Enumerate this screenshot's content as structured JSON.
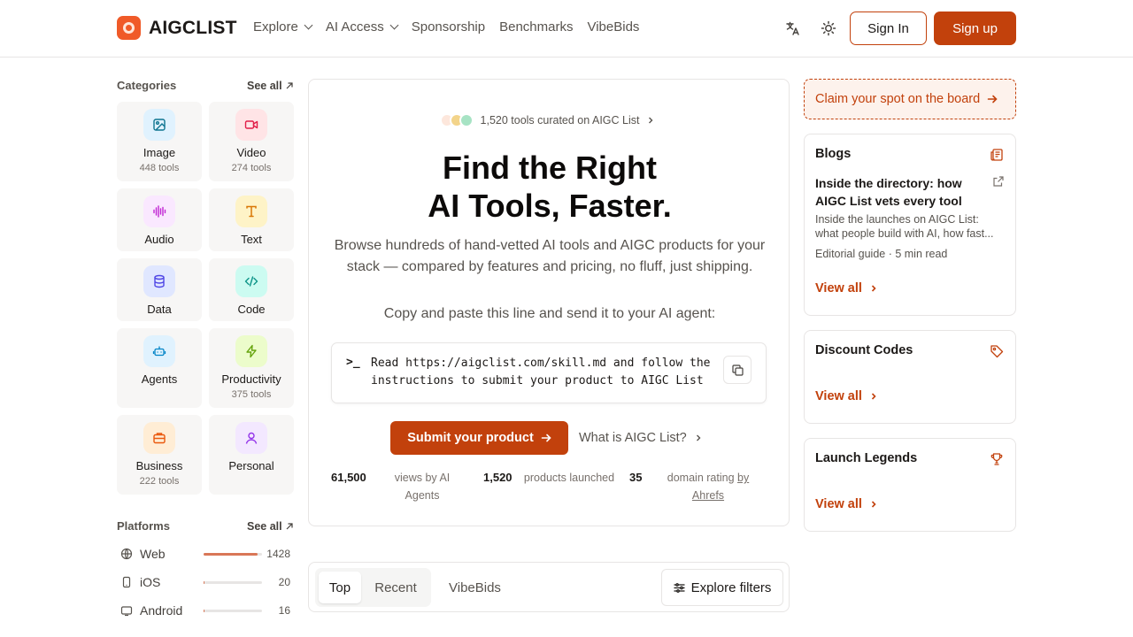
{
  "header": {
    "logo_text": "AIGCLIST",
    "nav": [
      {
        "label": "Explore",
        "dropdown": true
      },
      {
        "label": "AI Access",
        "dropdown": true
      },
      {
        "label": "Sponsorship",
        "dropdown": false
      },
      {
        "label": "Benchmarks",
        "dropdown": false
      },
      {
        "label": "VibeBids",
        "dropdown": false
      }
    ],
    "translate_icon": "translate-icon",
    "theme_icon": "sun-icon",
    "signin_label": "Sign In",
    "signup_label": "Sign up"
  },
  "categories": {
    "title": "Categories",
    "see_all": "See all",
    "items": [
      {
        "name": "Image",
        "count": "448 tools",
        "icon": "image-icon",
        "color": "#0e7490",
        "bg": "#e0f2fe"
      },
      {
        "name": "Video",
        "count": "274 tools",
        "icon": "video-icon",
        "color": "#e11d48",
        "bg": "#ffe4e6"
      },
      {
        "name": "Audio",
        "count": "",
        "icon": "audio-icon",
        "color": "#c026d3",
        "bg": "#fae8ff"
      },
      {
        "name": "Text",
        "count": "",
        "icon": "text-icon",
        "color": "#d97706",
        "bg": "#fef3c7"
      },
      {
        "name": "Data",
        "count": "",
        "icon": "database-icon",
        "color": "#4f46e5",
        "bg": "#e0e7ff"
      },
      {
        "name": "Code",
        "count": "",
        "icon": "code-icon",
        "color": "#0d9488",
        "bg": "#ccfbf1"
      },
      {
        "name": "Agents",
        "count": "",
        "icon": "robot-icon",
        "color": "#0284c7",
        "bg": "#e0f2fe"
      },
      {
        "name": "Productivity",
        "count": "375 tools",
        "icon": "lightning-icon",
        "color": "#65a30d",
        "bg": "#ecfccb"
      },
      {
        "name": "Business",
        "count": "222 tools",
        "icon": "briefcase-icon",
        "color": "#ea580c",
        "bg": "#ffedd5"
      },
      {
        "name": "Personal",
        "count": "",
        "icon": "user-icon",
        "color": "#9333ea",
        "bg": "#f3e8ff"
      }
    ]
  },
  "platforms": {
    "title": "Platforms",
    "see_all": "See all",
    "items": [
      {
        "name": "Web",
        "count": "1428",
        "share": 0.92,
        "icon": "globe-icon"
      },
      {
        "name": "iOS",
        "count": "20",
        "share": 0.015,
        "icon": "phone-icon"
      },
      {
        "name": "Android",
        "count": "16",
        "share": 0.012,
        "icon": "android-icon"
      }
    ]
  },
  "hero": {
    "curated": "1,520 tools curated on AIGC List",
    "dot_colors": [
      "#fde7dc",
      "#f3d48a",
      "#a7e3c4"
    ],
    "title_line1": "Find the Right",
    "title_line2": "AI Tools, Faster.",
    "description": "Browse hundreds of hand-vetted AI tools and AIGC products for your stack — compared by features and pricing, no fluff, just shipping.",
    "copy_prompt": "Copy and paste this line and send it to your AI agent:",
    "command_prompt": ">_",
    "command": "Read https://aigclist.com/skill.md and follow the instructions to submit your product to AIGC List",
    "submit_label": "Submit your product",
    "what_is_label": "What is AIGC List?",
    "stats": [
      {
        "value": "61,500",
        "label": "views by AI Agents"
      },
      {
        "value": "1,520",
        "label": "products launched"
      },
      {
        "value": "35",
        "label": "domain rating",
        "link": "by Ahrefs"
      }
    ]
  },
  "tabs": {
    "top": "Top",
    "recent": "Recent",
    "vibebids": "VibeBids",
    "filters_label": "Explore filters"
  },
  "right": {
    "claim_label": "Claim your spot on the board",
    "blogs": {
      "title": "Blogs",
      "post_title": "Inside the directory: how AIGC List vets every tool",
      "post_desc": "Inside the launches on AIGC List: what people build with AI, how fast...",
      "post_meta": "Editorial guide · 5 min read",
      "view_all": "View all"
    },
    "discounts": {
      "title": "Discount Codes",
      "view_all": "View all"
    },
    "legends": {
      "title": "Launch Legends",
      "view_all": "View all"
    }
  },
  "colors": {
    "accent": "#c2410c",
    "brand": "#f05a28"
  }
}
